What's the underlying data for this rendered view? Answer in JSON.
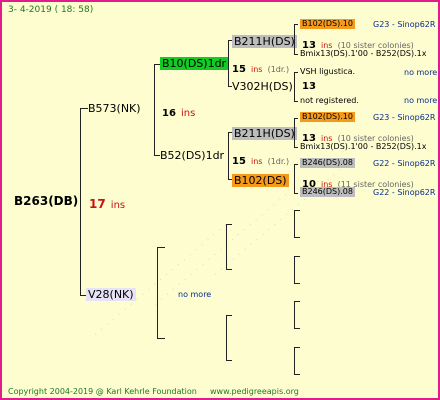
{
  "header": {
    "date": "3- 4-2019 ( 18: 58)"
  },
  "footer": {
    "copyright": "Copyright 2004-2019 @ Karl Kehrle Foundation",
    "site": "www.pedigreeapis.org"
  },
  "root": {
    "id": "B263(DB)",
    "ins_count": "17",
    "ins_label": "ins"
  },
  "gen1": {
    "sire": {
      "id": "B573(NK)",
      "ins_count": "16",
      "ins_label": "ins"
    },
    "dam": {
      "id": "V28(NK)",
      "note": "no more"
    }
  },
  "gen2": {
    "a": {
      "id": "B10(DS)1dr",
      "ins_count": "15",
      "ins_label": "ins",
      "dr": "(1dr.)"
    },
    "b": {
      "id": "B52(DS)1dr",
      "ins_count": "15",
      "ins_label": "ins",
      "dr": "(1dr.)"
    }
  },
  "gen3": {
    "a": {
      "id": "B211H(DS)"
    },
    "b": {
      "id": "V302H(DS)"
    },
    "c": {
      "id": "B211H(DS)"
    },
    "d": {
      "id": "B102(DS)"
    }
  },
  "gen4": {
    "g1": {
      "id": "B102(DS).10",
      "group": "G23 - Sinop62R",
      "count": "13",
      "ins": "ins",
      "sister": "(10 sister colonies)",
      "mix": "Bmix13(DS).1'00 - B252(DS).1x"
    },
    "g2": {
      "id": "VSH ligustica.",
      "more": "no more",
      "count": "13",
      "registered": "not registered.",
      "more2": "no more"
    },
    "g3": {
      "id": "B102(DS).10",
      "group": "G23 - Sinop62R",
      "count": "13",
      "ins": "ins",
      "sister": "(10 sister colonies)",
      "mix": "Bmix13(DS).1'00 - B252(DS).1x"
    },
    "g4": {
      "id": "B246(DS).08",
      "group": "G22 - Sinop62R",
      "count": "10",
      "ins": "ins",
      "sister": "(11 sister colonies)",
      "id2": "B246(DS).08",
      "group2": "G22 - Sinop62R"
    }
  },
  "colors": {
    "border": "#e01c8c",
    "background": "#fdfdd0",
    "ins": "#cc1111",
    "highlight_green": "#11cc22",
    "highlight_orange": "#f59a1b",
    "highlight_gray": "#bdbdbd"
  }
}
